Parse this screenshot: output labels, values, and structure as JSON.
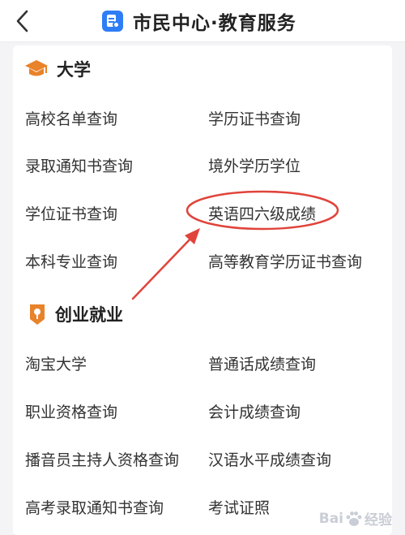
{
  "header": {
    "title": "市民中心·教育服务",
    "back_icon": "chevron-left-icon",
    "app_icon": "document-badge-icon",
    "app_icon_color": "#2f7df6"
  },
  "sections": [
    {
      "title": "大学",
      "icon": "graduation-cap-icon",
      "icon_color": "#e8832a",
      "items": [
        "高校名单查询",
        "学历证书查询",
        "录取通知书查询",
        "境外学历学位",
        "学位证书查询",
        "英语四六级成绩",
        "本科专业查询",
        "高等教育学历证书查询"
      ]
    },
    {
      "title": "创业就业",
      "icon": "badge-icon",
      "icon_color": "#e8832a",
      "items": [
        "淘宝大学",
        "普通话成绩查询",
        "职业资格查询",
        "会计成绩查询",
        "播音员主持人资格查询",
        "汉语水平成绩查询",
        "高考录取通知书查询",
        "考试证照"
      ]
    }
  ],
  "annotation": {
    "highlight_color": "#e0443b"
  },
  "watermark": {
    "text_left": "Bai",
    "text_right": "经验",
    "icon": "paw-icon"
  }
}
